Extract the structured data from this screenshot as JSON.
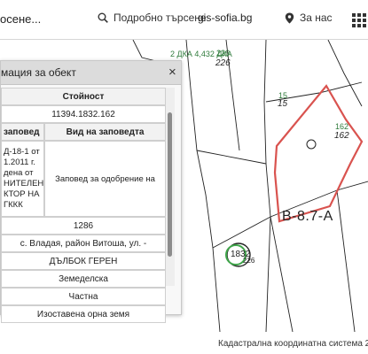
{
  "header": {
    "title_fragment": "осене...",
    "advanced_search_label": "Подробно търсене",
    "site_name": "gis-sofia.bg",
    "about_label": "За нас",
    "icons": [
      "search-icon",
      "location-pin-icon",
      "apps-grid-icon"
    ]
  },
  "map": {
    "parcel_labels": [
      "226",
      "226",
      "15",
      "15",
      "162",
      "162",
      "1832",
      "226"
    ],
    "small_text": "2 ДКА 4,432 ДКА",
    "zone_label": "В-8.7-А",
    "parcel_stroke_color": "#d9534f"
  },
  "panel": {
    "title": "мация за обект",
    "close_symbol": "×",
    "column_value": "Стойност",
    "row_id": "11394.1832.162",
    "col_order": "заповед",
    "col_order_type": "Вид на заповедта",
    "order_text": "Д-18-1 от 1.2011 г. дена от НИТЕЛЕН КТОР НА ГККК",
    "order_type_value": "Заповед за одобрение на КККР",
    "area": "1286",
    "address": "с. Владая, район Витоша, ул. -",
    "locality": "ДЪЛБОК ГЕРЕН",
    "land_use": "Земеделска",
    "ownership": "Частна",
    "purpose": "Изоставена орна земя"
  },
  "footer": {
    "coord_system": "Кадастрална координатна система 2"
  }
}
